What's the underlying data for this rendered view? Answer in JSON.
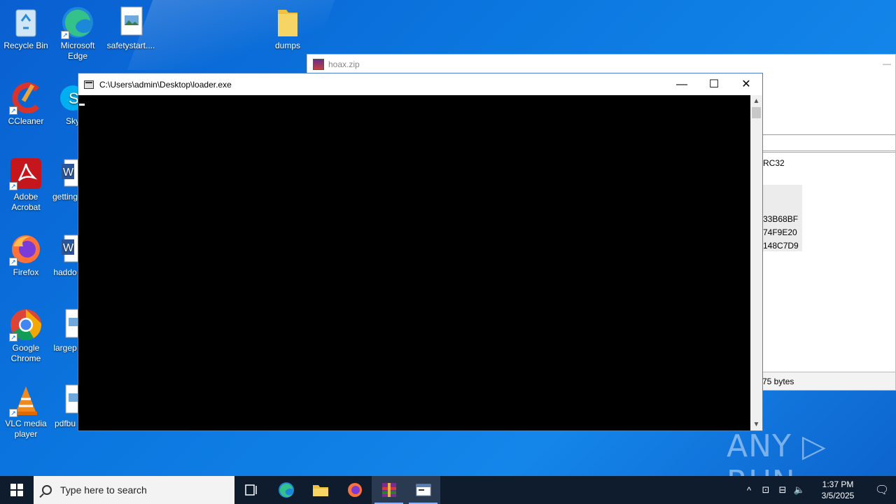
{
  "desktop": {
    "icons": [
      {
        "label": "Recycle Bin",
        "icon": "recycle-bin-icon"
      },
      {
        "label": "Microsoft Edge",
        "icon": "edge-icon"
      },
      {
        "label": "safetystart....",
        "icon": "image-file-icon"
      },
      {
        "label": "dumps",
        "icon": "folder-icon"
      },
      {
        "label": "CCleaner",
        "icon": "ccleaner-icon"
      },
      {
        "label": "Sky",
        "icon": "skype-icon"
      },
      {
        "label": "Adobe Acrobat",
        "icon": "acrobat-icon"
      },
      {
        "label": "getting",
        "icon": "word-doc-icon"
      },
      {
        "label": "Firefox",
        "icon": "firefox-icon"
      },
      {
        "label": "haddo",
        "icon": "word-doc-icon"
      },
      {
        "label": "Google Chrome",
        "icon": "chrome-icon"
      },
      {
        "label": "largep",
        "icon": "image-file-icon"
      },
      {
        "label": "VLC media player",
        "icon": "vlc-icon"
      },
      {
        "label": "pdfbu",
        "icon": "image-file-icon"
      }
    ]
  },
  "winrar_window": {
    "title": "hoax.zip",
    "minimize_glyph": "—",
    "crc_header": "RC32",
    "crc_values": [
      "33B68BF",
      "74F9E20",
      "148C7D9"
    ],
    "status": "75 bytes"
  },
  "console_window": {
    "title": "C:\\Users\\admin\\Desktop\\loader.exe",
    "minimize_glyph": "—",
    "maximize_glyph": "☐",
    "close_glyph": "✕"
  },
  "watermark": "ANY ▷ RUN",
  "taskbar": {
    "search_placeholder": "Type here to search",
    "time": "1:37 PM",
    "date": "3/5/2025",
    "apps": [
      "task-view-icon",
      "edge-icon",
      "file-explorer-icon",
      "firefox-icon",
      "winrar-icon",
      "console-icon"
    ]
  }
}
